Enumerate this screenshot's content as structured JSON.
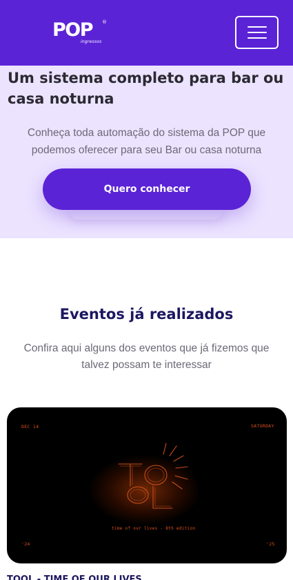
{
  "header": {
    "logo_text": "POP",
    "logo_sub": "ingressos",
    "logo_reg": "®",
    "menu_icon": "hamburger-menu-icon"
  },
  "hero": {
    "title": "Um sistema completo para bar ou casa noturna",
    "description": "Conheça toda automação do sistema da POP que podemos oferecer para seu Bar ou casa noturna",
    "cta_label": "Quero conhecer"
  },
  "events": {
    "title": "Eventos já realizados",
    "description": "Confira aqui alguns dos eventos que já fizemos que talvez possam te interessar",
    "items": [
      {
        "name": "TOOL - TIME OF OUR LIVES",
        "poster": {
          "date": "DEC 14",
          "day": "SATURDAY",
          "subtitle": "time of our lives - 8th edition",
          "year_left": "'24",
          "year_right": "'25"
        }
      }
    ]
  },
  "colors": {
    "brand": "#5b23d6",
    "hero_bg": "#ece3ff",
    "heading_dark": "#1b1760",
    "poster_accent": "#e0521c"
  }
}
